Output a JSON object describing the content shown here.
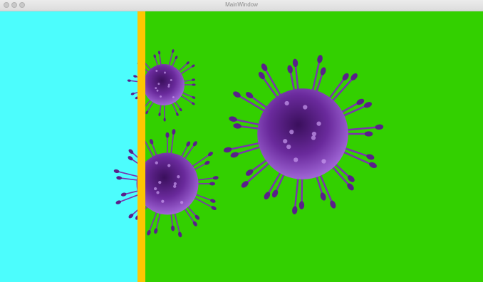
{
  "window": {
    "title": "MainWindow"
  },
  "colors": {
    "cyan_panel": "#4cfdfd",
    "green_field": "#33d000",
    "barrier": "#fdc602",
    "virus_body": "#6a2a9c",
    "virus_spike": "#7b32b0"
  },
  "sprites": [
    {
      "name": "virus-small",
      "icon": "virus-icon"
    },
    {
      "name": "virus-medium",
      "icon": "virus-icon"
    },
    {
      "name": "virus-large",
      "icon": "virus-icon"
    }
  ]
}
